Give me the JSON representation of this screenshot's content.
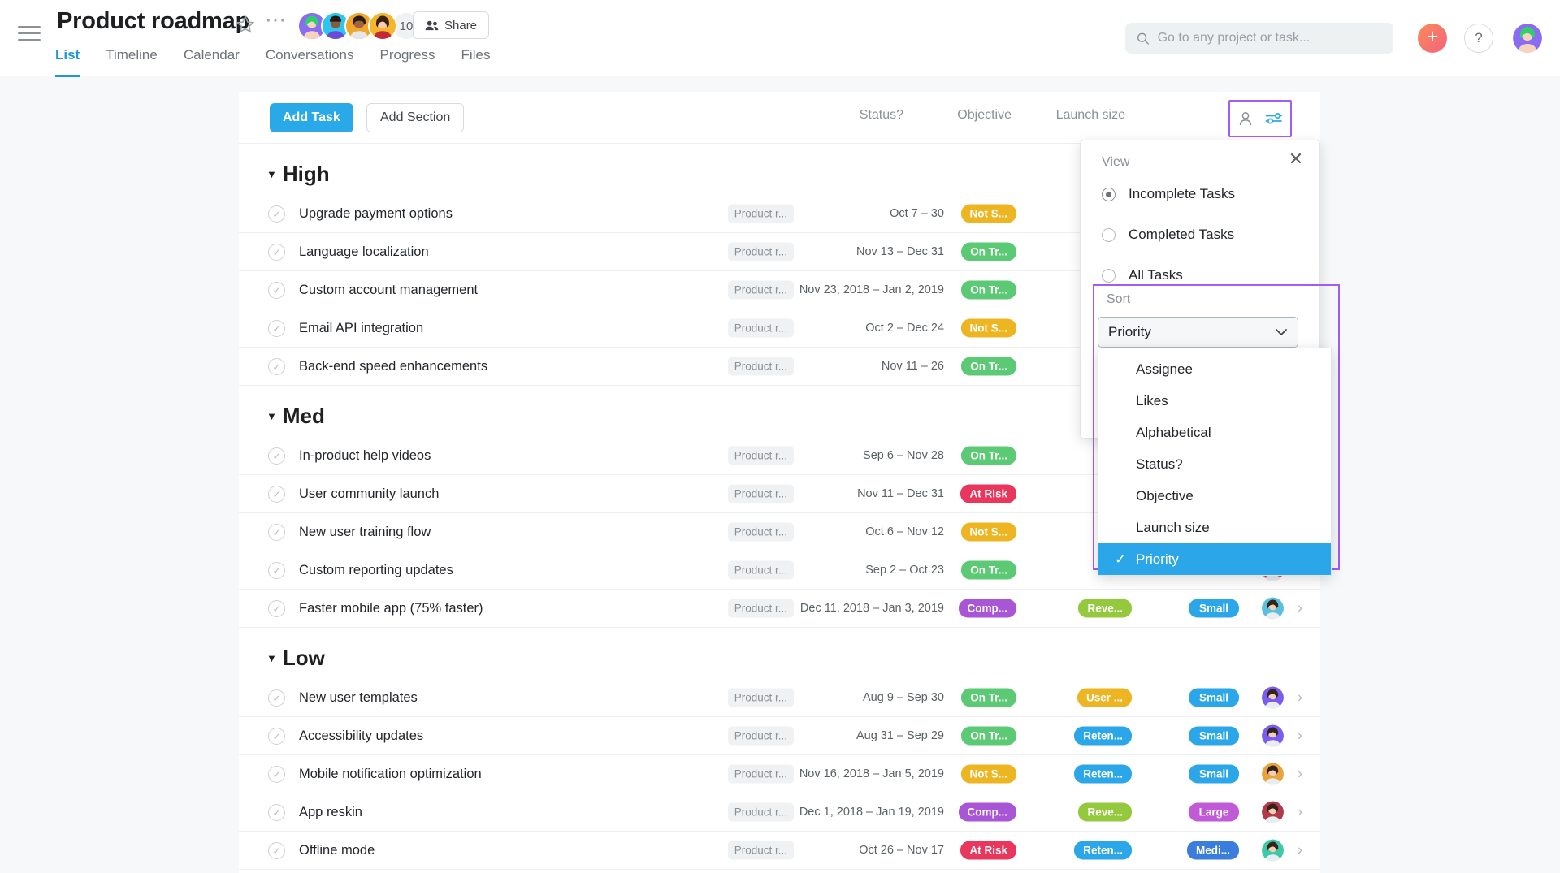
{
  "header": {
    "project_title": "Product roadmap",
    "member_count": "10",
    "share_label": "Share",
    "tabs": [
      {
        "label": "List",
        "active": true
      },
      {
        "label": "Timeline",
        "active": false
      },
      {
        "label": "Calendar",
        "active": false
      },
      {
        "label": "Conversations",
        "active": false
      },
      {
        "label": "Progress",
        "active": false
      },
      {
        "label": "Files",
        "active": false
      }
    ],
    "search_placeholder": "Go to any project or task...",
    "plus_label": "+",
    "help_label": "?"
  },
  "toolbar": {
    "add_task_label": "Add Task",
    "add_section_label": "Add Section",
    "columns": {
      "status": "Status?",
      "objective": "Objective",
      "launch_size": "Launch size"
    }
  },
  "view_popover": {
    "title": "View",
    "options": [
      {
        "label": "Incomplete Tasks",
        "selected": true
      },
      {
        "label": "Completed Tasks",
        "selected": false
      },
      {
        "label": "All Tasks",
        "selected": false
      }
    ]
  },
  "sort_popover": {
    "title": "Sort",
    "selected_value": "Priority",
    "options": [
      {
        "label": "Assignee",
        "selected": false
      },
      {
        "label": "Likes",
        "selected": false
      },
      {
        "label": "Alphabetical",
        "selected": false
      },
      {
        "label": "Status?",
        "selected": false
      },
      {
        "label": "Objective",
        "selected": false
      },
      {
        "label": "Launch size",
        "selected": false
      },
      {
        "label": "Priority",
        "selected": true
      }
    ]
  },
  "colors": {
    "accent_blue": "#29a9e8",
    "highlight_purple": "#a05cf5",
    "status_not_started": "#edb521",
    "status_on_track": "#5cc975",
    "status_at_risk": "#e8365d",
    "status_complete": "#a855d6",
    "objective_user": "#edb521",
    "objective_retention": "#2ba6e8",
    "objective_revenue": "#94c93d",
    "size_small": "#2ba6e8",
    "size_large": "#c05ad6",
    "size_medium": "#3b7ddd"
  },
  "sections": [
    {
      "name": "High",
      "tasks": [
        {
          "name": "Upgrade payment options",
          "project": "Product r...",
          "dates": "Oct 7 – 30",
          "status": {
            "label": "Not S...",
            "color": "#edb521"
          },
          "objective": null,
          "launch_size": null,
          "avatar": "#7b5cf0"
        },
        {
          "name": "Language localization",
          "project": "Product r...",
          "dates": "Nov 13 – Dec 31",
          "status": {
            "label": "On Tr...",
            "color": "#5cc975"
          },
          "objective": null,
          "launch_size": null,
          "avatar": "#e8a33d"
        },
        {
          "name": "Custom account management",
          "project": "Product r...",
          "dates": "Nov 23, 2018 – Jan 2, 2019",
          "status": {
            "label": "On Tr...",
            "color": "#5cc975"
          },
          "objective": null,
          "launch_size": null,
          "avatar": "#2ba6e8"
        },
        {
          "name": "Email API integration",
          "project": "Product r...",
          "dates": "Oct 2 – Dec 24",
          "status": {
            "label": "Not S...",
            "color": "#edb521"
          },
          "objective": null,
          "launch_size": null,
          "avatar": "#e8536a"
        },
        {
          "name": "Back-end speed enhancements",
          "project": "Product r...",
          "dates": "Nov 11 – 26",
          "status": {
            "label": "On Tr...",
            "color": "#5cc975"
          },
          "objective": null,
          "launch_size": null,
          "avatar": "#3dc9a8"
        }
      ]
    },
    {
      "name": "Med",
      "tasks": [
        {
          "name": "In-product help videos",
          "project": "Product r...",
          "dates": "Sep 6 – Nov 28",
          "status": {
            "label": "On Tr...",
            "color": "#5cc975"
          },
          "objective": null,
          "launch_size": null,
          "avatar": "#7b5cf0"
        },
        {
          "name": "User community launch",
          "project": "Product r...",
          "dates": "Nov 11 – Dec 31",
          "status": {
            "label": "At Risk",
            "color": "#e8365d"
          },
          "objective": null,
          "launch_size": null,
          "avatar": "#e8a33d"
        },
        {
          "name": "New user training flow",
          "project": "Product r...",
          "dates": "Oct 6 – Nov 12",
          "status": {
            "label": "Not S...",
            "color": "#edb521"
          },
          "objective": null,
          "launch_size": null,
          "avatar": "#2ba6e8"
        },
        {
          "name": "Custom reporting updates",
          "project": "Product r...",
          "dates": "Sep 2 – Oct 23",
          "status": {
            "label": "On Tr...",
            "color": "#5cc975"
          },
          "objective": null,
          "launch_size": null,
          "avatar": "#e8536a"
        },
        {
          "name": "Faster mobile app (75% faster)",
          "project": "Product r...",
          "dates": "Dec 11, 2018 – Jan 3, 2019",
          "status": {
            "label": "Comp...",
            "color": "#a855d6"
          },
          "objective": {
            "label": "Reve...",
            "color": "#94c93d"
          },
          "launch_size": {
            "label": "Small",
            "color": "#2ba6e8"
          },
          "avatar": "#5bc0de"
        }
      ]
    },
    {
      "name": "Low",
      "tasks": [
        {
          "name": "New user templates",
          "project": "Product r...",
          "dates": "Aug 9 – Sep 30",
          "status": {
            "label": "On Tr...",
            "color": "#5cc975"
          },
          "objective": {
            "label": "User ...",
            "color": "#edb521"
          },
          "launch_size": {
            "label": "Small",
            "color": "#2ba6e8"
          },
          "avatar": "#7b5cf0"
        },
        {
          "name": "Accessibility updates",
          "project": "Product r...",
          "dates": "Aug 31 – Sep 29",
          "status": {
            "label": "On Tr...",
            "color": "#5cc975"
          },
          "objective": {
            "label": "Reten...",
            "color": "#2ba6e8"
          },
          "launch_size": {
            "label": "Small",
            "color": "#2ba6e8"
          },
          "avatar": "#7b5cf0"
        },
        {
          "name": "Mobile notification optimization",
          "project": "Product r...",
          "dates": "Nov 16, 2018 – Jan 5, 2019",
          "status": {
            "label": "Not S...",
            "color": "#edb521"
          },
          "objective": {
            "label": "Reten...",
            "color": "#2ba6e8"
          },
          "launch_size": {
            "label": "Small",
            "color": "#2ba6e8"
          },
          "avatar": "#e8a33d"
        },
        {
          "name": "App reskin",
          "project": "Product r...",
          "dates": "Dec 1, 2018 – Jan 19, 2019",
          "status": {
            "label": "Comp...",
            "color": "#a855d6"
          },
          "objective": {
            "label": "Reve...",
            "color": "#94c93d"
          },
          "launch_size": {
            "label": "Large",
            "color": "#c05ad6"
          },
          "avatar": "#b03a4a"
        },
        {
          "name": "Offline mode",
          "project": "Product r...",
          "dates": "Oct 26 – Nov 17",
          "status": {
            "label": "At Risk",
            "color": "#e8365d"
          },
          "objective": {
            "label": "Reten...",
            "color": "#2ba6e8"
          },
          "launch_size": {
            "label": "Medi...",
            "color": "#3b7ddd"
          },
          "avatar": "#3dc9a8"
        }
      ]
    }
  ]
}
